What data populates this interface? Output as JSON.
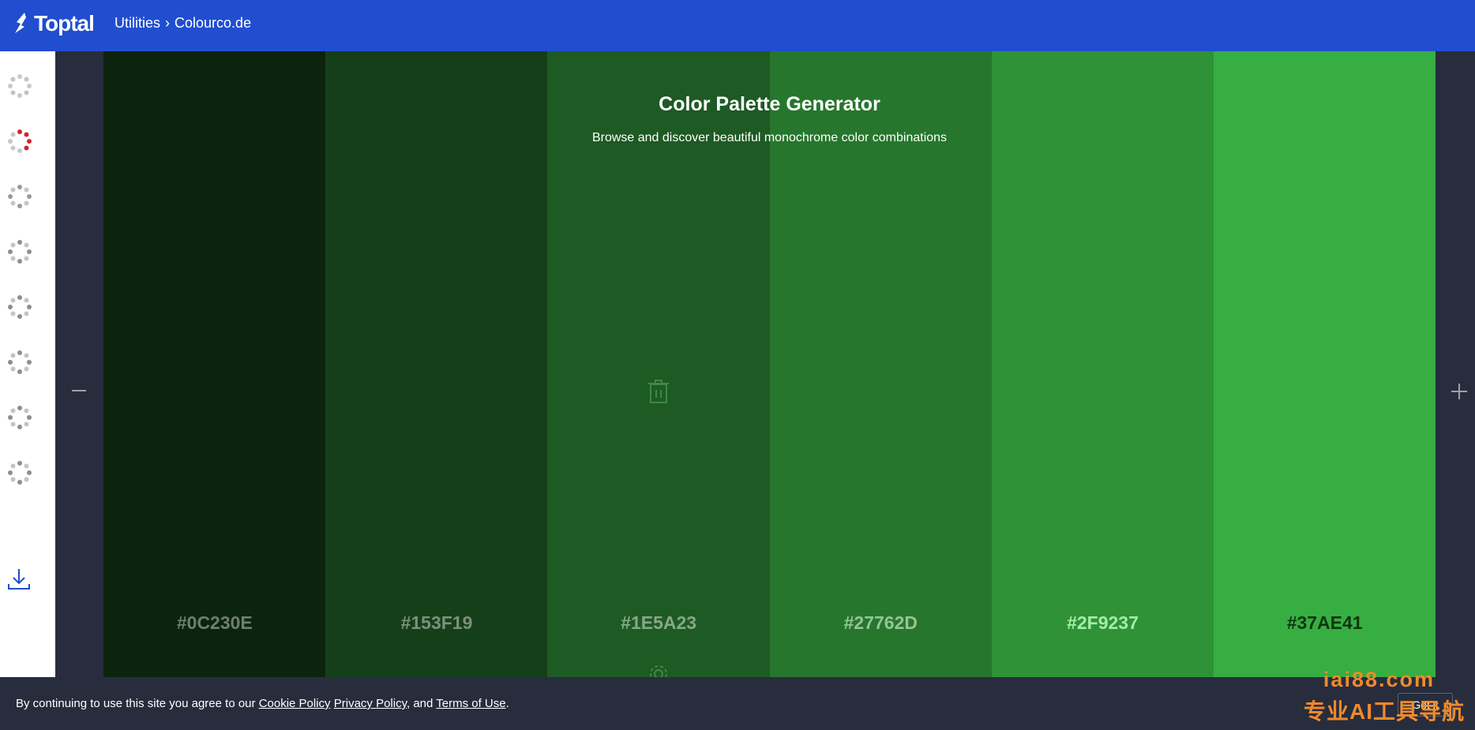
{
  "topbar": {
    "logo_text": "Toptal",
    "breadcrumb": {
      "utilities": "Utilities",
      "separator": "›",
      "current": "Colourco.de"
    }
  },
  "sidebar": {
    "items": [
      {
        "icon": "dots-circle-light-icon",
        "dot_color": "#c9c9c9",
        "active": false
      },
      {
        "icon": "dots-circle-red-icon",
        "dot_color": "#d0242f",
        "active": true
      },
      {
        "icon": "dots-circle-icon",
        "dot_color": "#9a9a9a",
        "active": false
      },
      {
        "icon": "dots-circle-icon",
        "dot_color": "#8e8e8e",
        "active": false
      },
      {
        "icon": "dots-circle-icon",
        "dot_color": "#8e8e8e",
        "active": false
      },
      {
        "icon": "dots-circle-icon",
        "dot_color": "#8e8e8e",
        "active": false
      },
      {
        "icon": "dots-circle-icon",
        "dot_color": "#8e8e8e",
        "active": false
      },
      {
        "icon": "dots-circle-icon",
        "dot_color": "#8e8e8e",
        "active": false
      }
    ],
    "download_icon": "download-icon"
  },
  "main": {
    "title": "Color Palette Generator",
    "subtitle": "Browse and discover beautiful monochrome color combinations"
  },
  "palette": {
    "swatches": [
      {
        "hex": "#0C230E",
        "color": "#0C230E",
        "text_color": "#6f7f70"
      },
      {
        "hex": "#153F19",
        "color": "#153F19",
        "text_color": "#7a917c"
      },
      {
        "hex": "#1E5A23",
        "color": "#1E5A23",
        "text_color": "#86a889"
      },
      {
        "hex": "#27762D",
        "color": "#27762D",
        "text_color": "#93c598"
      },
      {
        "hex": "#2F9237",
        "color": "#2F9237",
        "text_color": "#a6eca9"
      },
      {
        "hex": "#37AE41",
        "color": "#37AE41",
        "text_color": "#0d3611"
      }
    ]
  },
  "controls": {
    "remove_label": "—",
    "add_label": "+"
  },
  "cookie": {
    "prefix": "By continuing to use this site you agree to our ",
    "cookie_policy": "Cookie Policy",
    "space": " ",
    "privacy_policy": "Privacy Policy",
    "and": ", and ",
    "terms": "Terms of Use",
    "period": ".",
    "button": "Got it"
  },
  "watermark": {
    "line1": "iai88.com",
    "line2": "专业AI工具导航"
  },
  "colors": {
    "brand": "#204ecf",
    "dark": "#272d3d"
  }
}
